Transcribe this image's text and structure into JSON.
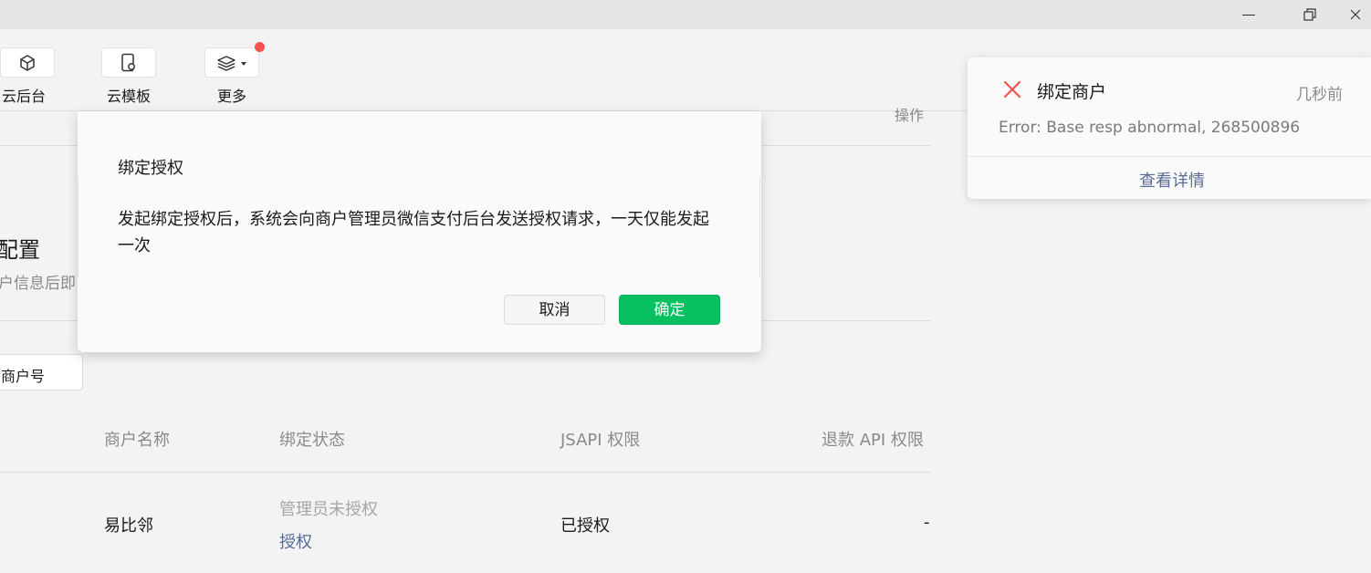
{
  "toolbar": {
    "items": [
      {
        "label": "云后台",
        "icon": "cube-icon"
      },
      {
        "label": "云模板",
        "icon": "phone-template-icon"
      },
      {
        "label": "更多",
        "icon": "layers-icon"
      }
    ]
  },
  "table_header_partial": "操作",
  "section": {
    "title": "配置",
    "desc": "户信息后即"
  },
  "merchant_button": "商户号",
  "table": {
    "columns": [
      "商户名称",
      "绑定状态",
      "JSAPI 权限",
      "退款 API 权限"
    ],
    "rows": [
      {
        "name": "易比邻",
        "status": "管理员未授权",
        "action": "授权",
        "jsapi": "已授权",
        "refund": "-"
      }
    ]
  },
  "modal": {
    "title": "绑定授权",
    "body": "发起绑定授权后，系统会向商户管理员微信支付后台发送授权请求，一天仅能发起一次",
    "cancel": "取消",
    "confirm": "确定"
  },
  "toast": {
    "title": "绑定商户",
    "time": "几秒前",
    "message": "Error: Base resp abnormal, 268500896",
    "link": "查看详情"
  },
  "colors": {
    "primary_green": "#07c160",
    "link_blue": "#576b95",
    "error_red": "#f5544e"
  }
}
